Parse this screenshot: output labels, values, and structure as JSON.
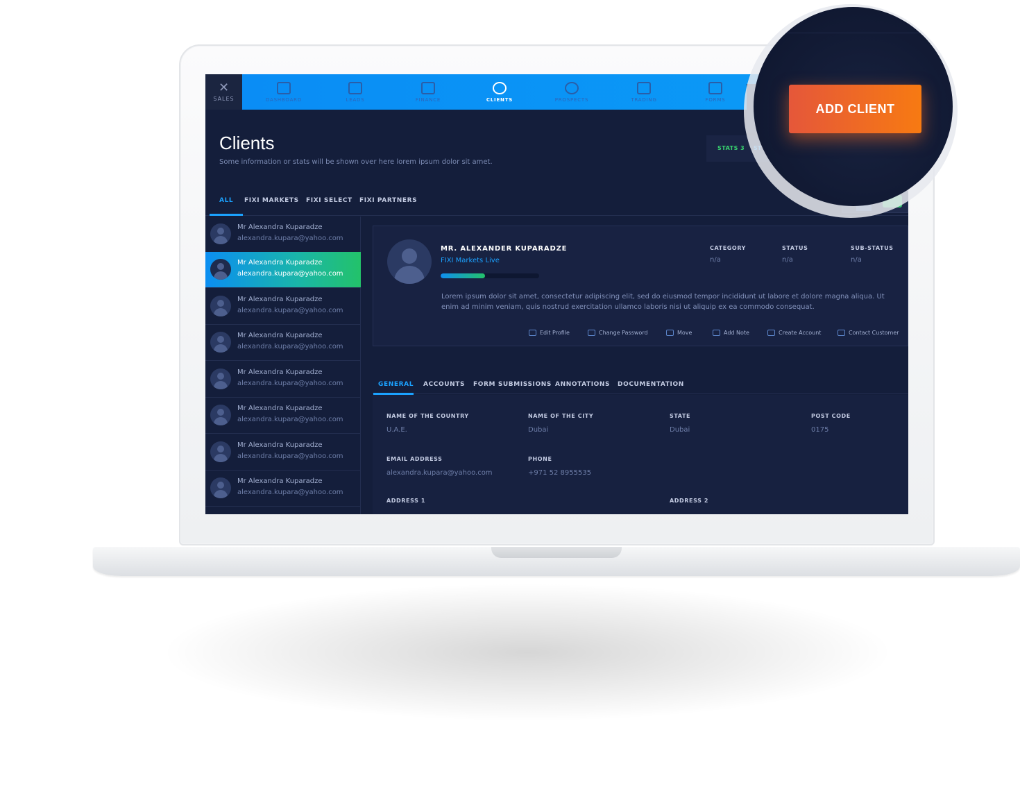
{
  "brand": {
    "logo_glyph": "✕",
    "label": "SALES"
  },
  "nav": {
    "items": [
      {
        "label": "DASHBOARD",
        "icon": "monitor-icon"
      },
      {
        "label": "LEADS",
        "icon": "bar-chart-icon"
      },
      {
        "label": "FINANCE",
        "icon": "finance-icon"
      },
      {
        "label": "CLIENTS",
        "icon": "globe-icon",
        "active": true
      },
      {
        "label": "PROSPECTS",
        "icon": "target-icon"
      },
      {
        "label": "TRADING",
        "icon": "trading-chart-icon"
      },
      {
        "label": "FORMS",
        "icon": "form-icon"
      }
    ]
  },
  "header": {
    "title": "Clients",
    "subtitle": "Some information or stats will be shown over here lorem ipsum dolor sit amet.",
    "stats_label": "STATS 3",
    "stats_label_cut": "ST"
  },
  "filter_tabs": [
    "ALL",
    "FIXI MARKETS",
    "FIXI SELECT",
    "FIXI PARTNERS"
  ],
  "clients": [
    {
      "name": "Mr Alexandra Kuparadze",
      "email": "alexandra.kupara@yahoo.com"
    },
    {
      "name": "Mr Alexandra Kuparadze",
      "email": "alexandra.kupara@yahoo.com",
      "selected": true
    },
    {
      "name": "Mr Alexandra Kuparadze",
      "email": "alexandra.kupara@yahoo.com"
    },
    {
      "name": "Mr Alexandra Kuparadze",
      "email": "alexandra.kupara@yahoo.com"
    },
    {
      "name": "Mr Alexandra Kuparadze",
      "email": "alexandra.kupara@yahoo.com"
    },
    {
      "name": "Mr Alexandra Kuparadze",
      "email": "alexandra.kupara@yahoo.com"
    },
    {
      "name": "Mr Alexandra Kuparadze",
      "email": "alexandra.kupara@yahoo.com"
    },
    {
      "name": "Mr Alexandra Kuparadze",
      "email": "alexandra.kupara@yahoo.com"
    }
  ],
  "profile": {
    "name": "MR. ALEXANDER KUPARADZE",
    "account_type": "FIXI Markets Live",
    "progress": 0.45,
    "category_label": "CATEGORY",
    "category_value": "n/a",
    "status_label": "STATUS",
    "status_value": "n/a",
    "substatus_label": "SUB-STATUS",
    "substatus_value": "n/a",
    "description": "Lorem ipsum dolor sit amet, consectetur adipiscing elit, sed do eiusmod tempor incididunt ut labore et dolore magna aliqua. Ut enim ad minim veniam, quis nostrud exercitation ullamco laboris nisi ut aliquip ex ea commodo consequat.",
    "actions": [
      "Edit Profile",
      "Change Password",
      "Move",
      "Add Note",
      "Create Account",
      "Contact Customer"
    ]
  },
  "detail_tabs": [
    "GENERAL",
    "ACCOUNTS",
    "FORM SUBMISSIONS",
    "ANNOTATIONS",
    "DOCUMENTATION"
  ],
  "general": {
    "country_label": "NAME OF THE COUNTRY",
    "country": "U.A.E.",
    "city_label": "NAME OF THE CITY",
    "city": "Dubai",
    "state_label": "STATE",
    "state": "Dubai",
    "postcode_label": "POST CODE",
    "postcode": "0175",
    "email_label": "EMAIL ADDRESS",
    "email": "alexandra.kupara@yahoo.com",
    "phone_label": "PHONE",
    "phone": "+971 52 8955535",
    "address1_label": "ADDRESS 1",
    "address2_label": "ADDRESS 2"
  },
  "zoom": {
    "add_client_label": "ADD CLIENT"
  },
  "colors": {
    "accent_blue": "#1ba2ff",
    "accent_green": "#23c26a",
    "cta_orange": "#f77a12",
    "background": "#141e3b"
  }
}
